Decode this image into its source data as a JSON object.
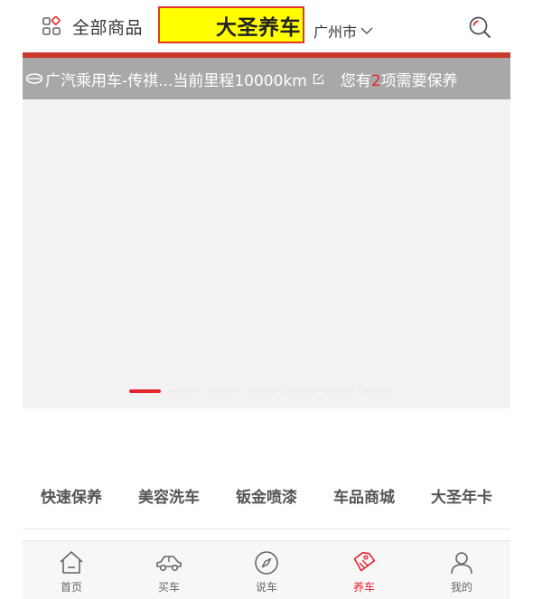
{
  "header": {
    "all_products_label": "全部商品",
    "brand": "大圣养车",
    "city": "广州市"
  },
  "car_bar": {
    "car_name": "广汽乘用车-传祺...",
    "mileage": "当前里程10000km",
    "maint_prefix": "您有",
    "maint_count": "2",
    "maint_suffix": "项需要保养"
  },
  "banner": {
    "slide_count": 7,
    "active_slide": 1
  },
  "quick_menu": [
    "快速保养",
    "美容洗车",
    "钣金喷漆",
    "车品商城",
    "大圣年卡"
  ],
  "tabs": [
    {
      "label": "首页",
      "icon": "home-icon",
      "active": false
    },
    {
      "label": "买车",
      "icon": "car-icon",
      "active": false
    },
    {
      "label": "说车",
      "icon": "compass-icon",
      "active": false
    },
    {
      "label": "养车",
      "icon": "tag-icon",
      "active": true
    },
    {
      "label": "我的",
      "icon": "user-icon",
      "active": false
    }
  ],
  "colors": {
    "accent": "#e8242d",
    "brand_bg": "#ffff00",
    "brand_border": "#e0352a",
    "car_bar_bg": "#a8a8a8",
    "banner_topline": "#c9392a",
    "banner_bg": "#f2f2f2",
    "tabbar_bg": "#f7f7f7"
  }
}
